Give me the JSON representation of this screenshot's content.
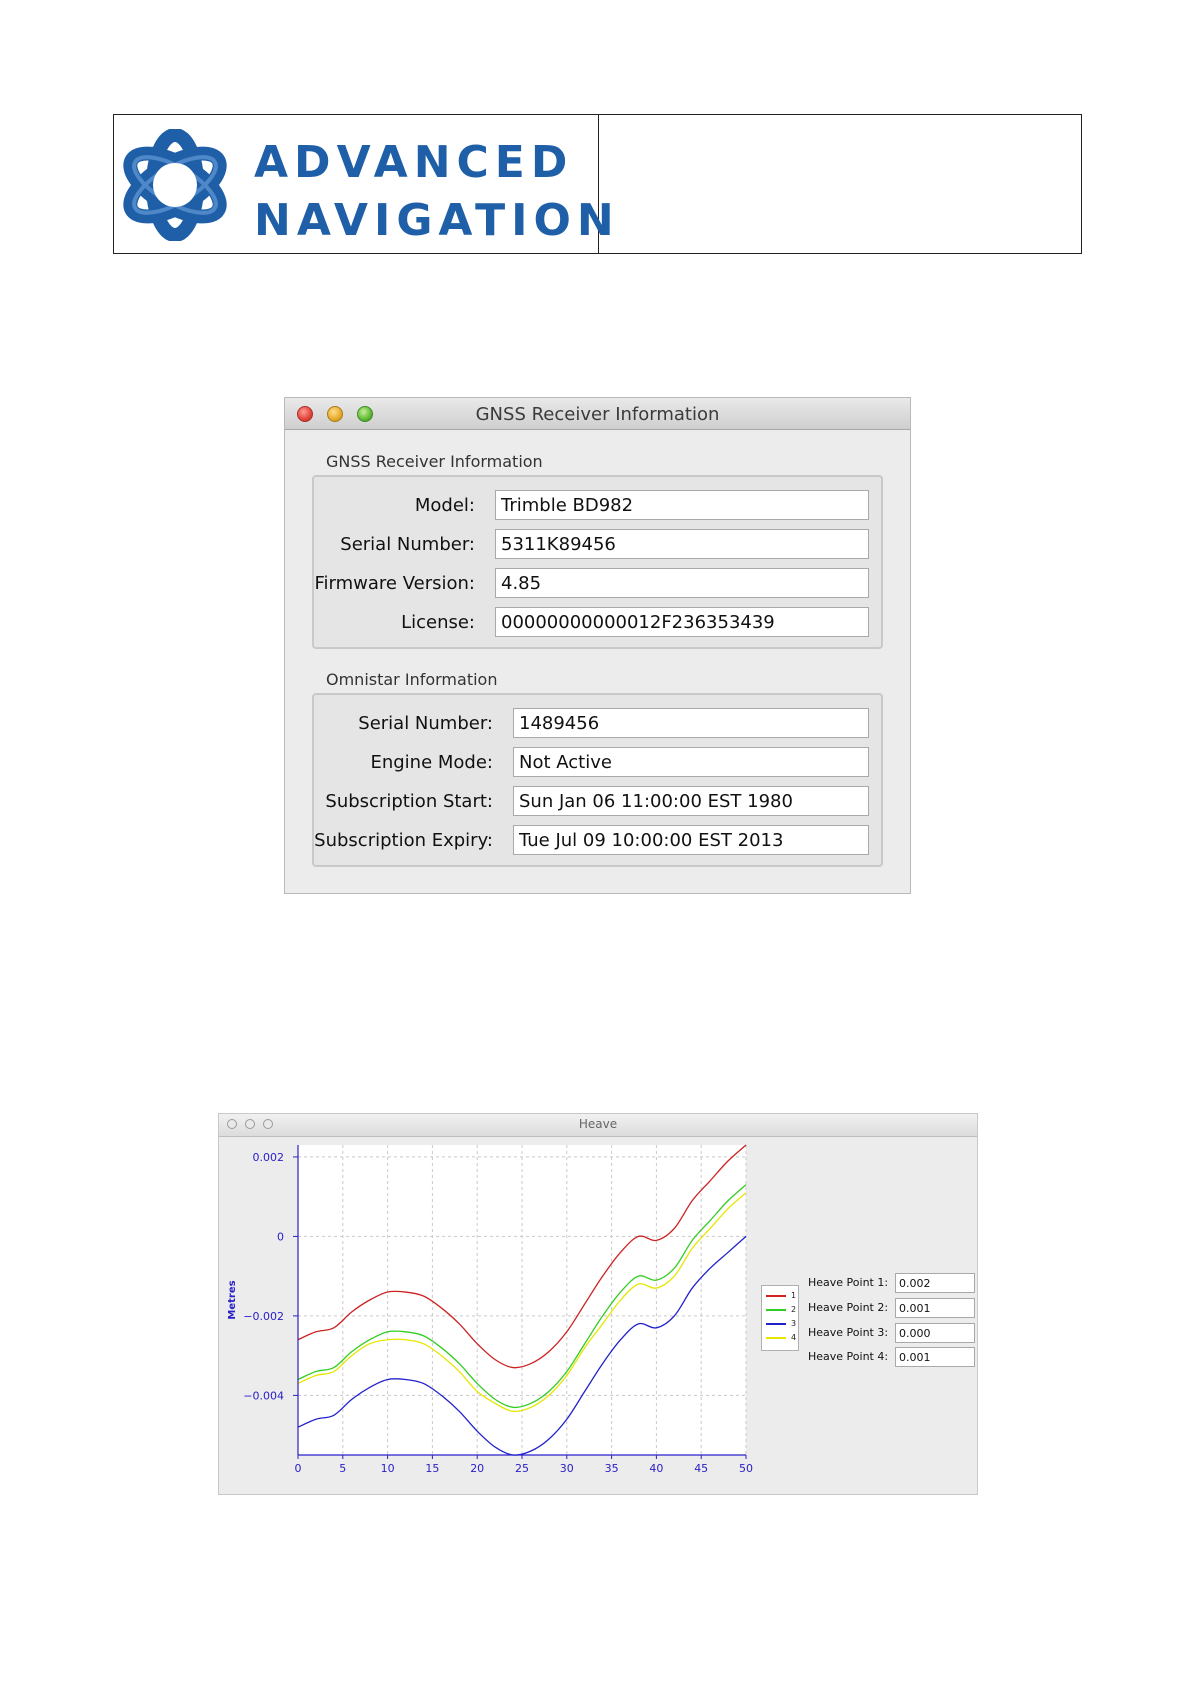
{
  "header": {
    "logo_line1": "ADVANCED",
    "logo_line2": "NAVIGATION",
    "brand_color": "#1f5fa8"
  },
  "gnss_window": {
    "title": "GNSS Receiver Information",
    "receiver_section": {
      "label": "GNSS Receiver Information",
      "rows": [
        {
          "label": "Model:",
          "value": "Trimble BD982"
        },
        {
          "label": "Serial Number:",
          "value": "5311K89456"
        },
        {
          "label": "Firmware Version:",
          "value": "4.85"
        },
        {
          "label": "License:",
          "value": "00000000000012F236353439"
        }
      ]
    },
    "omnistar_section": {
      "label": "Omnistar Information",
      "rows": [
        {
          "label": "Serial Number:",
          "value": "1489456"
        },
        {
          "label": "Engine Mode:",
          "value": "Not Active"
        },
        {
          "label": "Subscription Start:",
          "value": "Sun Jan 06 11:00:00 EST 1980"
        },
        {
          "label": "Subscription Expiry:",
          "value": "Tue Jul 09 10:00:00 EST 2013"
        }
      ]
    }
  },
  "heave_window": {
    "title": "Heave",
    "heave_points": [
      {
        "label": "Heave Point 1:",
        "value": "0.002"
      },
      {
        "label": "Heave Point 2:",
        "value": "0.001"
      },
      {
        "label": "Heave Point 3:",
        "value": "0.000"
      },
      {
        "label": "Heave Point 4:",
        "value": "0.001"
      }
    ]
  },
  "chart_data": {
    "type": "line",
    "title": "",
    "xlabel": "",
    "ylabel": "Metres",
    "xlim": [
      0,
      50
    ],
    "ylim": [
      -0.0055,
      0.0023
    ],
    "x_ticks": [
      "0",
      "5",
      "10",
      "15",
      "20",
      "25",
      "30",
      "35",
      "40",
      "45",
      "50"
    ],
    "y_ticks": [
      {
        "value": 0.002,
        "label": "0.002"
      },
      {
        "value": 0,
        "label": "0"
      },
      {
        "value": -0.002,
        "label": "−0.002"
      },
      {
        "value": -0.004,
        "label": "−0.004"
      }
    ],
    "grid": true,
    "legend_position": "right",
    "x": [
      0,
      2,
      4,
      6,
      8,
      10,
      12,
      14,
      16,
      18,
      20,
      22,
      24,
      26,
      28,
      30,
      32,
      34,
      36,
      38,
      40,
      42,
      44,
      46,
      48,
      50
    ],
    "series": [
      {
        "name": "1",
        "color": "#cc2222",
        "values": [
          -0.0026,
          -0.0024,
          -0.0023,
          -0.0019,
          -0.0016,
          -0.0014,
          -0.0014,
          -0.0015,
          -0.0018,
          -0.0022,
          -0.0027,
          -0.0031,
          -0.0033,
          -0.0032,
          -0.0029,
          -0.0024,
          -0.0017,
          -0.001,
          -0.0004,
          0.0,
          -0.0001,
          0.0002,
          0.0009,
          0.0014,
          0.0019,
          0.0023
        ]
      },
      {
        "name": "2",
        "color": "#33cc22",
        "values": [
          -0.0036,
          -0.0034,
          -0.0033,
          -0.0029,
          -0.0026,
          -0.0024,
          -0.0024,
          -0.0025,
          -0.0028,
          -0.0032,
          -0.0037,
          -0.0041,
          -0.0043,
          -0.0042,
          -0.0039,
          -0.0034,
          -0.0027,
          -0.002,
          -0.0014,
          -0.001,
          -0.0011,
          -0.0008,
          -0.0001,
          0.0004,
          0.0009,
          0.0013
        ]
      },
      {
        "name": "3",
        "color": "#2222cc",
        "values": [
          -0.0048,
          -0.0046,
          -0.0045,
          -0.0041,
          -0.0038,
          -0.0036,
          -0.0036,
          -0.0037,
          -0.004,
          -0.0044,
          -0.0049,
          -0.0053,
          -0.0055,
          -0.0054,
          -0.0051,
          -0.0046,
          -0.0039,
          -0.0032,
          -0.0026,
          -0.0022,
          -0.0023,
          -0.002,
          -0.0013,
          -0.0008,
          -0.0004,
          0.0
        ]
      },
      {
        "name": "4",
        "color": "#e6e600",
        "values": [
          -0.0037,
          -0.0035,
          -0.0034,
          -0.003,
          -0.0027,
          -0.0026,
          -0.0026,
          -0.0027,
          -0.003,
          -0.0034,
          -0.0039,
          -0.0042,
          -0.0044,
          -0.0043,
          -0.004,
          -0.0035,
          -0.0028,
          -0.0022,
          -0.0016,
          -0.0012,
          -0.0013,
          -0.001,
          -0.0003,
          0.0002,
          0.0007,
          0.0011
        ]
      }
    ]
  }
}
